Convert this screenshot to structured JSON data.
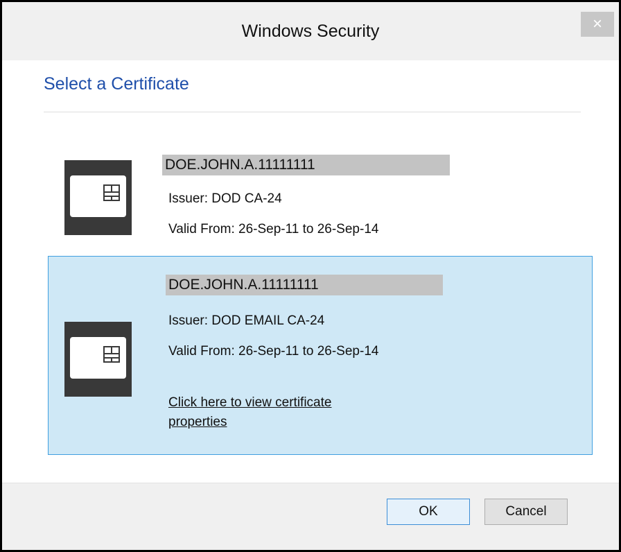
{
  "window": {
    "title": "Windows Security",
    "close_glyph": "×"
  },
  "heading": "Select a Certificate",
  "certificates": [
    {
      "name": "DOE.JOHN.A.11111111",
      "issuer": "Issuer: DOD CA-24",
      "valid": "Valid From: 26-Sep-11 to 26-Sep-14",
      "selected": false
    },
    {
      "name": "DOE.JOHN.A.11111111",
      "issuer": "Issuer: DOD EMAIL CA-24",
      "valid": "Valid From: 26-Sep-11 to 26-Sep-14",
      "selected": true,
      "link": "Click here to view certificate properties"
    }
  ],
  "buttons": {
    "ok": "OK",
    "cancel": "Cancel"
  },
  "icons": {
    "certificate": "smart-card-icon",
    "close": "close-icon"
  },
  "colors": {
    "heading": "#1f4faa",
    "selection_bg": "#cfe8f6",
    "selection_border": "#3f9fe0",
    "default_button_border": "#3c8ed7"
  }
}
